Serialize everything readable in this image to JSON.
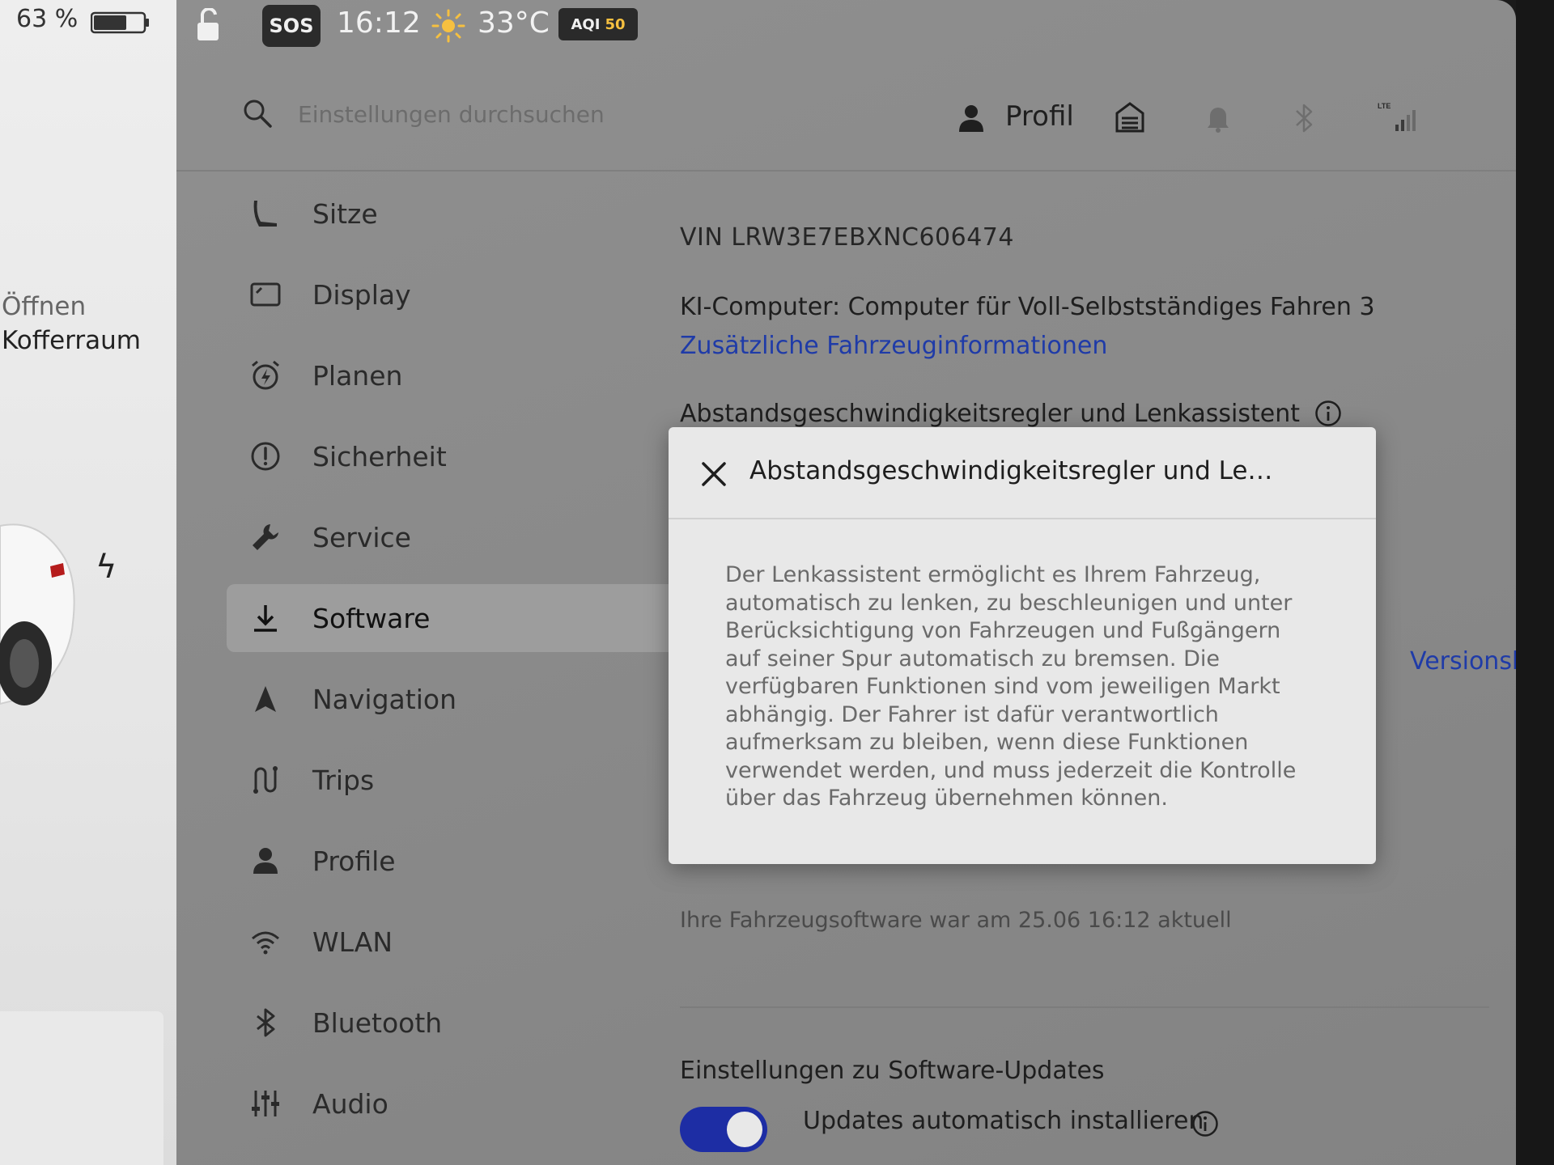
{
  "car_panel": {
    "battery_percent": "63 %",
    "trunk_label_line1": "Öffnen",
    "trunk_label_line2": "Kofferraum"
  },
  "status_bar": {
    "sos_label": "SOS",
    "time": "16:12",
    "temperature": "33°C",
    "aqi_label": "AQI",
    "aqi_value": "50",
    "lte_label": "LTE"
  },
  "header": {
    "search_placeholder": "Einstellungen durchsuchen",
    "profile_label": "Profil"
  },
  "sidebar": {
    "items": [
      {
        "label": "Sitze",
        "icon": "seat-icon",
        "active": false
      },
      {
        "label": "Display",
        "icon": "display-icon",
        "active": false
      },
      {
        "label": "Planen",
        "icon": "alarm-clock-icon",
        "active": false
      },
      {
        "label": "Sicherheit",
        "icon": "exclamation-circle-icon",
        "active": false
      },
      {
        "label": "Service",
        "icon": "wrench-icon",
        "active": false
      },
      {
        "label": "Software",
        "icon": "download-icon",
        "active": true
      },
      {
        "label": "Navigation",
        "icon": "navigation-arrow-icon",
        "active": false
      },
      {
        "label": "Trips",
        "icon": "trips-icon",
        "active": false
      },
      {
        "label": "Profile",
        "icon": "person-icon",
        "active": false
      },
      {
        "label": "WLAN",
        "icon": "wifi-icon",
        "active": false
      },
      {
        "label": "Bluetooth",
        "icon": "bluetooth-icon",
        "active": false
      },
      {
        "label": "Audio",
        "icon": "equalizer-icon",
        "active": false
      }
    ]
  },
  "content": {
    "vin": "VIN LRW3E7EBXNC606474",
    "ai_computer": "KI-Computer: Computer für Voll-Selbstständiges Fahren 3",
    "vehicle_info_link": "Zusätzliche Fahrzeuginformationen",
    "tacc_label": "Abstandsgeschwindigkeitsregler und Lenkassistent",
    "release_notes_link": "Versionshinweise",
    "software_status": "Ihre Fahrzeugsoftware war am 25.06 16:12 aktuell",
    "update_settings_title": "Einstellungen zu Software-Updates",
    "auto_install_label": "Updates automatisch installieren",
    "auto_install_enabled": true
  },
  "modal": {
    "title": "Abstandsgeschwindigkeitsregler und Le…",
    "body": "Der Lenkassistent ermöglicht es Ihrem Fahrzeug, automatisch zu lenken, zu beschleunigen und unter Berücksichtigung von Fahrzeugen und Fußgängern auf seiner Spur automatisch zu bremsen. Die verfügbaren Funktionen sind vom jeweiligen Markt abhängig. Der Fahrer ist dafür verantwortlich aufmerksam zu bleiben, wenn diese Funktionen verwendet werden, und muss jederzeit die Kontrolle über das Fahrzeug übernehmen können."
  },
  "colors": {
    "link": "#1f3ba8",
    "toggle_on": "#1d2da4",
    "aqi_good": "#f6c040"
  }
}
